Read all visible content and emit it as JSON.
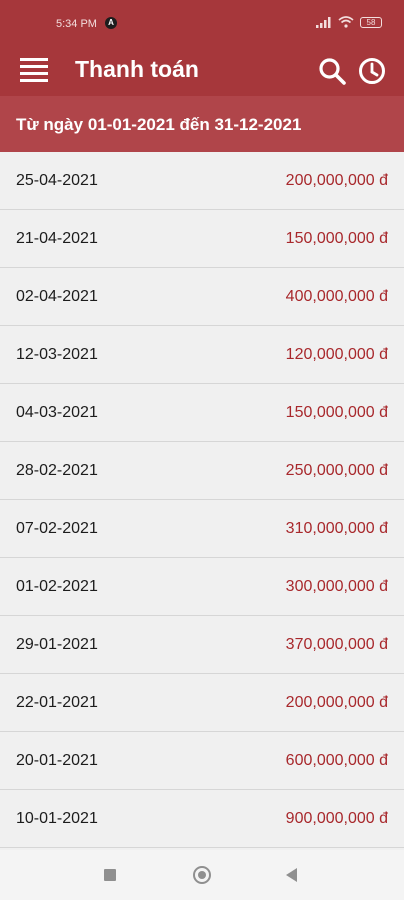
{
  "status_bar": {
    "time": "5:34 PM",
    "badge": "A",
    "battery": "58"
  },
  "app_bar": {
    "title": "Thanh toán",
    "icons": [
      "menu-icon",
      "search-icon",
      "history-icon"
    ]
  },
  "date_range": {
    "label": "Từ ngày 01-01-2021 đến 31-12-2021"
  },
  "payments": [
    {
      "date": "25-04-2021",
      "amount": "200,000,000 đ"
    },
    {
      "date": "21-04-2021",
      "amount": "150,000,000 đ"
    },
    {
      "date": "02-04-2021",
      "amount": "400,000,000 đ"
    },
    {
      "date": "12-03-2021",
      "amount": "120,000,000 đ"
    },
    {
      "date": "04-03-2021",
      "amount": "150,000,000 đ"
    },
    {
      "date": "28-02-2021",
      "amount": "250,000,000 đ"
    },
    {
      "date": "07-02-2021",
      "amount": "310,000,000 đ"
    },
    {
      "date": "01-02-2021",
      "amount": "300,000,000 đ"
    },
    {
      "date": "29-01-2021",
      "amount": "370,000,000 đ"
    },
    {
      "date": "22-01-2021",
      "amount": "200,000,000 đ"
    },
    {
      "date": "20-01-2021",
      "amount": "600,000,000 đ"
    },
    {
      "date": "10-01-2021",
      "amount": "900,000,000 đ"
    }
  ],
  "colors": {
    "app_bar": "#a6373b",
    "date_range_bar": "#b0454a",
    "amount_text": "#a8282c",
    "list_background": "#f0f0f0"
  }
}
